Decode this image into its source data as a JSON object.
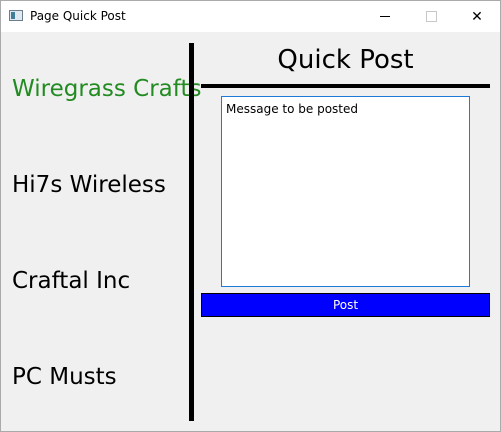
{
  "window": {
    "title": "Page Quick Post"
  },
  "sidebar": {
    "items": [
      {
        "label": "Wiregrass Crafts",
        "active": true
      },
      {
        "label": "Hi7s Wireless",
        "active": false
      },
      {
        "label": "Craftal Inc",
        "active": false
      },
      {
        "label": "PC Musts",
        "active": false
      }
    ]
  },
  "main": {
    "heading": "Quick Post",
    "message_value": "Message to be posted",
    "post_label": "Post"
  },
  "colors": {
    "active_item": "#228B22",
    "post_button": "#0000ff",
    "input_border": "#1c7bd8"
  }
}
